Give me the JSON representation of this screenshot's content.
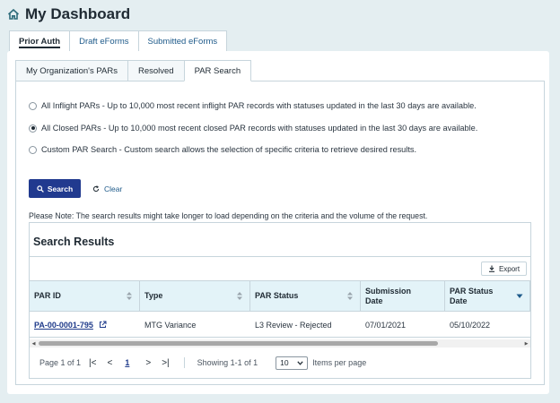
{
  "header": {
    "title": "My Dashboard",
    "icon": "home-icon"
  },
  "top_tabs": [
    "Prior Auth",
    "Draft eForms",
    "Submitted eForms"
  ],
  "sub_tabs": [
    "My Organization's PARs",
    "Resolved",
    "PAR Search"
  ],
  "search_options": [
    {
      "label": "All Inflight PARs - Up to 10,000 most recent inflight PAR records with statuses updated in the last 30 days are available.",
      "checked": false
    },
    {
      "label": "All Closed PARs - Up to 10,000 most recent closed PAR records with statuses updated in the last 30 days are available.",
      "checked": true
    },
    {
      "label": "Custom PAR Search - Custom search allows the selection of specific criteria to retrieve desired results.",
      "checked": false
    }
  ],
  "buttons": {
    "search": "Search",
    "clear": "Clear",
    "export": "Export"
  },
  "note": "Please Note:  The search results might take longer to load depending on the criteria and the volume of the request.",
  "results": {
    "title": "Search Results",
    "columns": [
      "PAR ID",
      "Type",
      "PAR Status",
      "Submission Date",
      "PAR Status Date"
    ],
    "rows": [
      {
        "par_id": "PA-00-0001-795",
        "type": "MTG Variance",
        "status": "L3 Review - Rejected",
        "submission_date": "07/01/2021",
        "status_date": "05/10/2022"
      }
    ]
  },
  "pagination": {
    "page_label": "Page 1 of 1",
    "first": "|<",
    "prev": "<",
    "current": "1",
    "next": ">",
    "last": ">|",
    "showing": "Showing 1-1 of 1",
    "per_page": "10",
    "per_page_label": "Items per page"
  },
  "colors": {
    "primary": "#213a8f",
    "link": "#1e3a8a",
    "header_bg": "#e3f3f8",
    "page_bg": "#e4eef1"
  }
}
